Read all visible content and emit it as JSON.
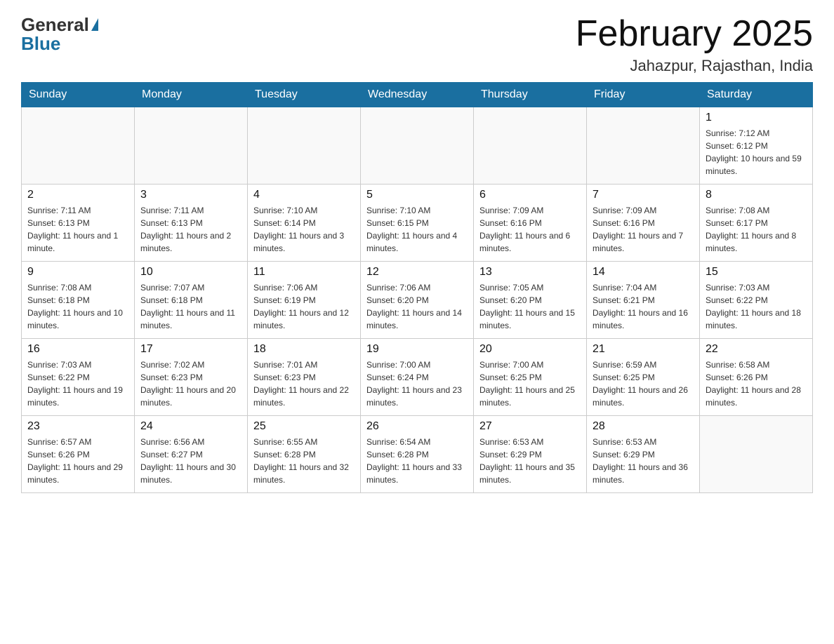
{
  "header": {
    "logo_general": "General",
    "logo_blue": "Blue",
    "month_title": "February 2025",
    "location": "Jahazpur, Rajasthan, India"
  },
  "days_of_week": [
    "Sunday",
    "Monday",
    "Tuesday",
    "Wednesday",
    "Thursday",
    "Friday",
    "Saturday"
  ],
  "weeks": [
    [
      {
        "day": "",
        "info": ""
      },
      {
        "day": "",
        "info": ""
      },
      {
        "day": "",
        "info": ""
      },
      {
        "day": "",
        "info": ""
      },
      {
        "day": "",
        "info": ""
      },
      {
        "day": "",
        "info": ""
      },
      {
        "day": "1",
        "info": "Sunrise: 7:12 AM\nSunset: 6:12 PM\nDaylight: 10 hours and 59 minutes."
      }
    ],
    [
      {
        "day": "2",
        "info": "Sunrise: 7:11 AM\nSunset: 6:13 PM\nDaylight: 11 hours and 1 minute."
      },
      {
        "day": "3",
        "info": "Sunrise: 7:11 AM\nSunset: 6:13 PM\nDaylight: 11 hours and 2 minutes."
      },
      {
        "day": "4",
        "info": "Sunrise: 7:10 AM\nSunset: 6:14 PM\nDaylight: 11 hours and 3 minutes."
      },
      {
        "day": "5",
        "info": "Sunrise: 7:10 AM\nSunset: 6:15 PM\nDaylight: 11 hours and 4 minutes."
      },
      {
        "day": "6",
        "info": "Sunrise: 7:09 AM\nSunset: 6:16 PM\nDaylight: 11 hours and 6 minutes."
      },
      {
        "day": "7",
        "info": "Sunrise: 7:09 AM\nSunset: 6:16 PM\nDaylight: 11 hours and 7 minutes."
      },
      {
        "day": "8",
        "info": "Sunrise: 7:08 AM\nSunset: 6:17 PM\nDaylight: 11 hours and 8 minutes."
      }
    ],
    [
      {
        "day": "9",
        "info": "Sunrise: 7:08 AM\nSunset: 6:18 PM\nDaylight: 11 hours and 10 minutes."
      },
      {
        "day": "10",
        "info": "Sunrise: 7:07 AM\nSunset: 6:18 PM\nDaylight: 11 hours and 11 minutes."
      },
      {
        "day": "11",
        "info": "Sunrise: 7:06 AM\nSunset: 6:19 PM\nDaylight: 11 hours and 12 minutes."
      },
      {
        "day": "12",
        "info": "Sunrise: 7:06 AM\nSunset: 6:20 PM\nDaylight: 11 hours and 14 minutes."
      },
      {
        "day": "13",
        "info": "Sunrise: 7:05 AM\nSunset: 6:20 PM\nDaylight: 11 hours and 15 minutes."
      },
      {
        "day": "14",
        "info": "Sunrise: 7:04 AM\nSunset: 6:21 PM\nDaylight: 11 hours and 16 minutes."
      },
      {
        "day": "15",
        "info": "Sunrise: 7:03 AM\nSunset: 6:22 PM\nDaylight: 11 hours and 18 minutes."
      }
    ],
    [
      {
        "day": "16",
        "info": "Sunrise: 7:03 AM\nSunset: 6:22 PM\nDaylight: 11 hours and 19 minutes."
      },
      {
        "day": "17",
        "info": "Sunrise: 7:02 AM\nSunset: 6:23 PM\nDaylight: 11 hours and 20 minutes."
      },
      {
        "day": "18",
        "info": "Sunrise: 7:01 AM\nSunset: 6:23 PM\nDaylight: 11 hours and 22 minutes."
      },
      {
        "day": "19",
        "info": "Sunrise: 7:00 AM\nSunset: 6:24 PM\nDaylight: 11 hours and 23 minutes."
      },
      {
        "day": "20",
        "info": "Sunrise: 7:00 AM\nSunset: 6:25 PM\nDaylight: 11 hours and 25 minutes."
      },
      {
        "day": "21",
        "info": "Sunrise: 6:59 AM\nSunset: 6:25 PM\nDaylight: 11 hours and 26 minutes."
      },
      {
        "day": "22",
        "info": "Sunrise: 6:58 AM\nSunset: 6:26 PM\nDaylight: 11 hours and 28 minutes."
      }
    ],
    [
      {
        "day": "23",
        "info": "Sunrise: 6:57 AM\nSunset: 6:26 PM\nDaylight: 11 hours and 29 minutes."
      },
      {
        "day": "24",
        "info": "Sunrise: 6:56 AM\nSunset: 6:27 PM\nDaylight: 11 hours and 30 minutes."
      },
      {
        "day": "25",
        "info": "Sunrise: 6:55 AM\nSunset: 6:28 PM\nDaylight: 11 hours and 32 minutes."
      },
      {
        "day": "26",
        "info": "Sunrise: 6:54 AM\nSunset: 6:28 PM\nDaylight: 11 hours and 33 minutes."
      },
      {
        "day": "27",
        "info": "Sunrise: 6:53 AM\nSunset: 6:29 PM\nDaylight: 11 hours and 35 minutes."
      },
      {
        "day": "28",
        "info": "Sunrise: 6:53 AM\nSunset: 6:29 PM\nDaylight: 11 hours and 36 minutes."
      },
      {
        "day": "",
        "info": ""
      }
    ]
  ]
}
